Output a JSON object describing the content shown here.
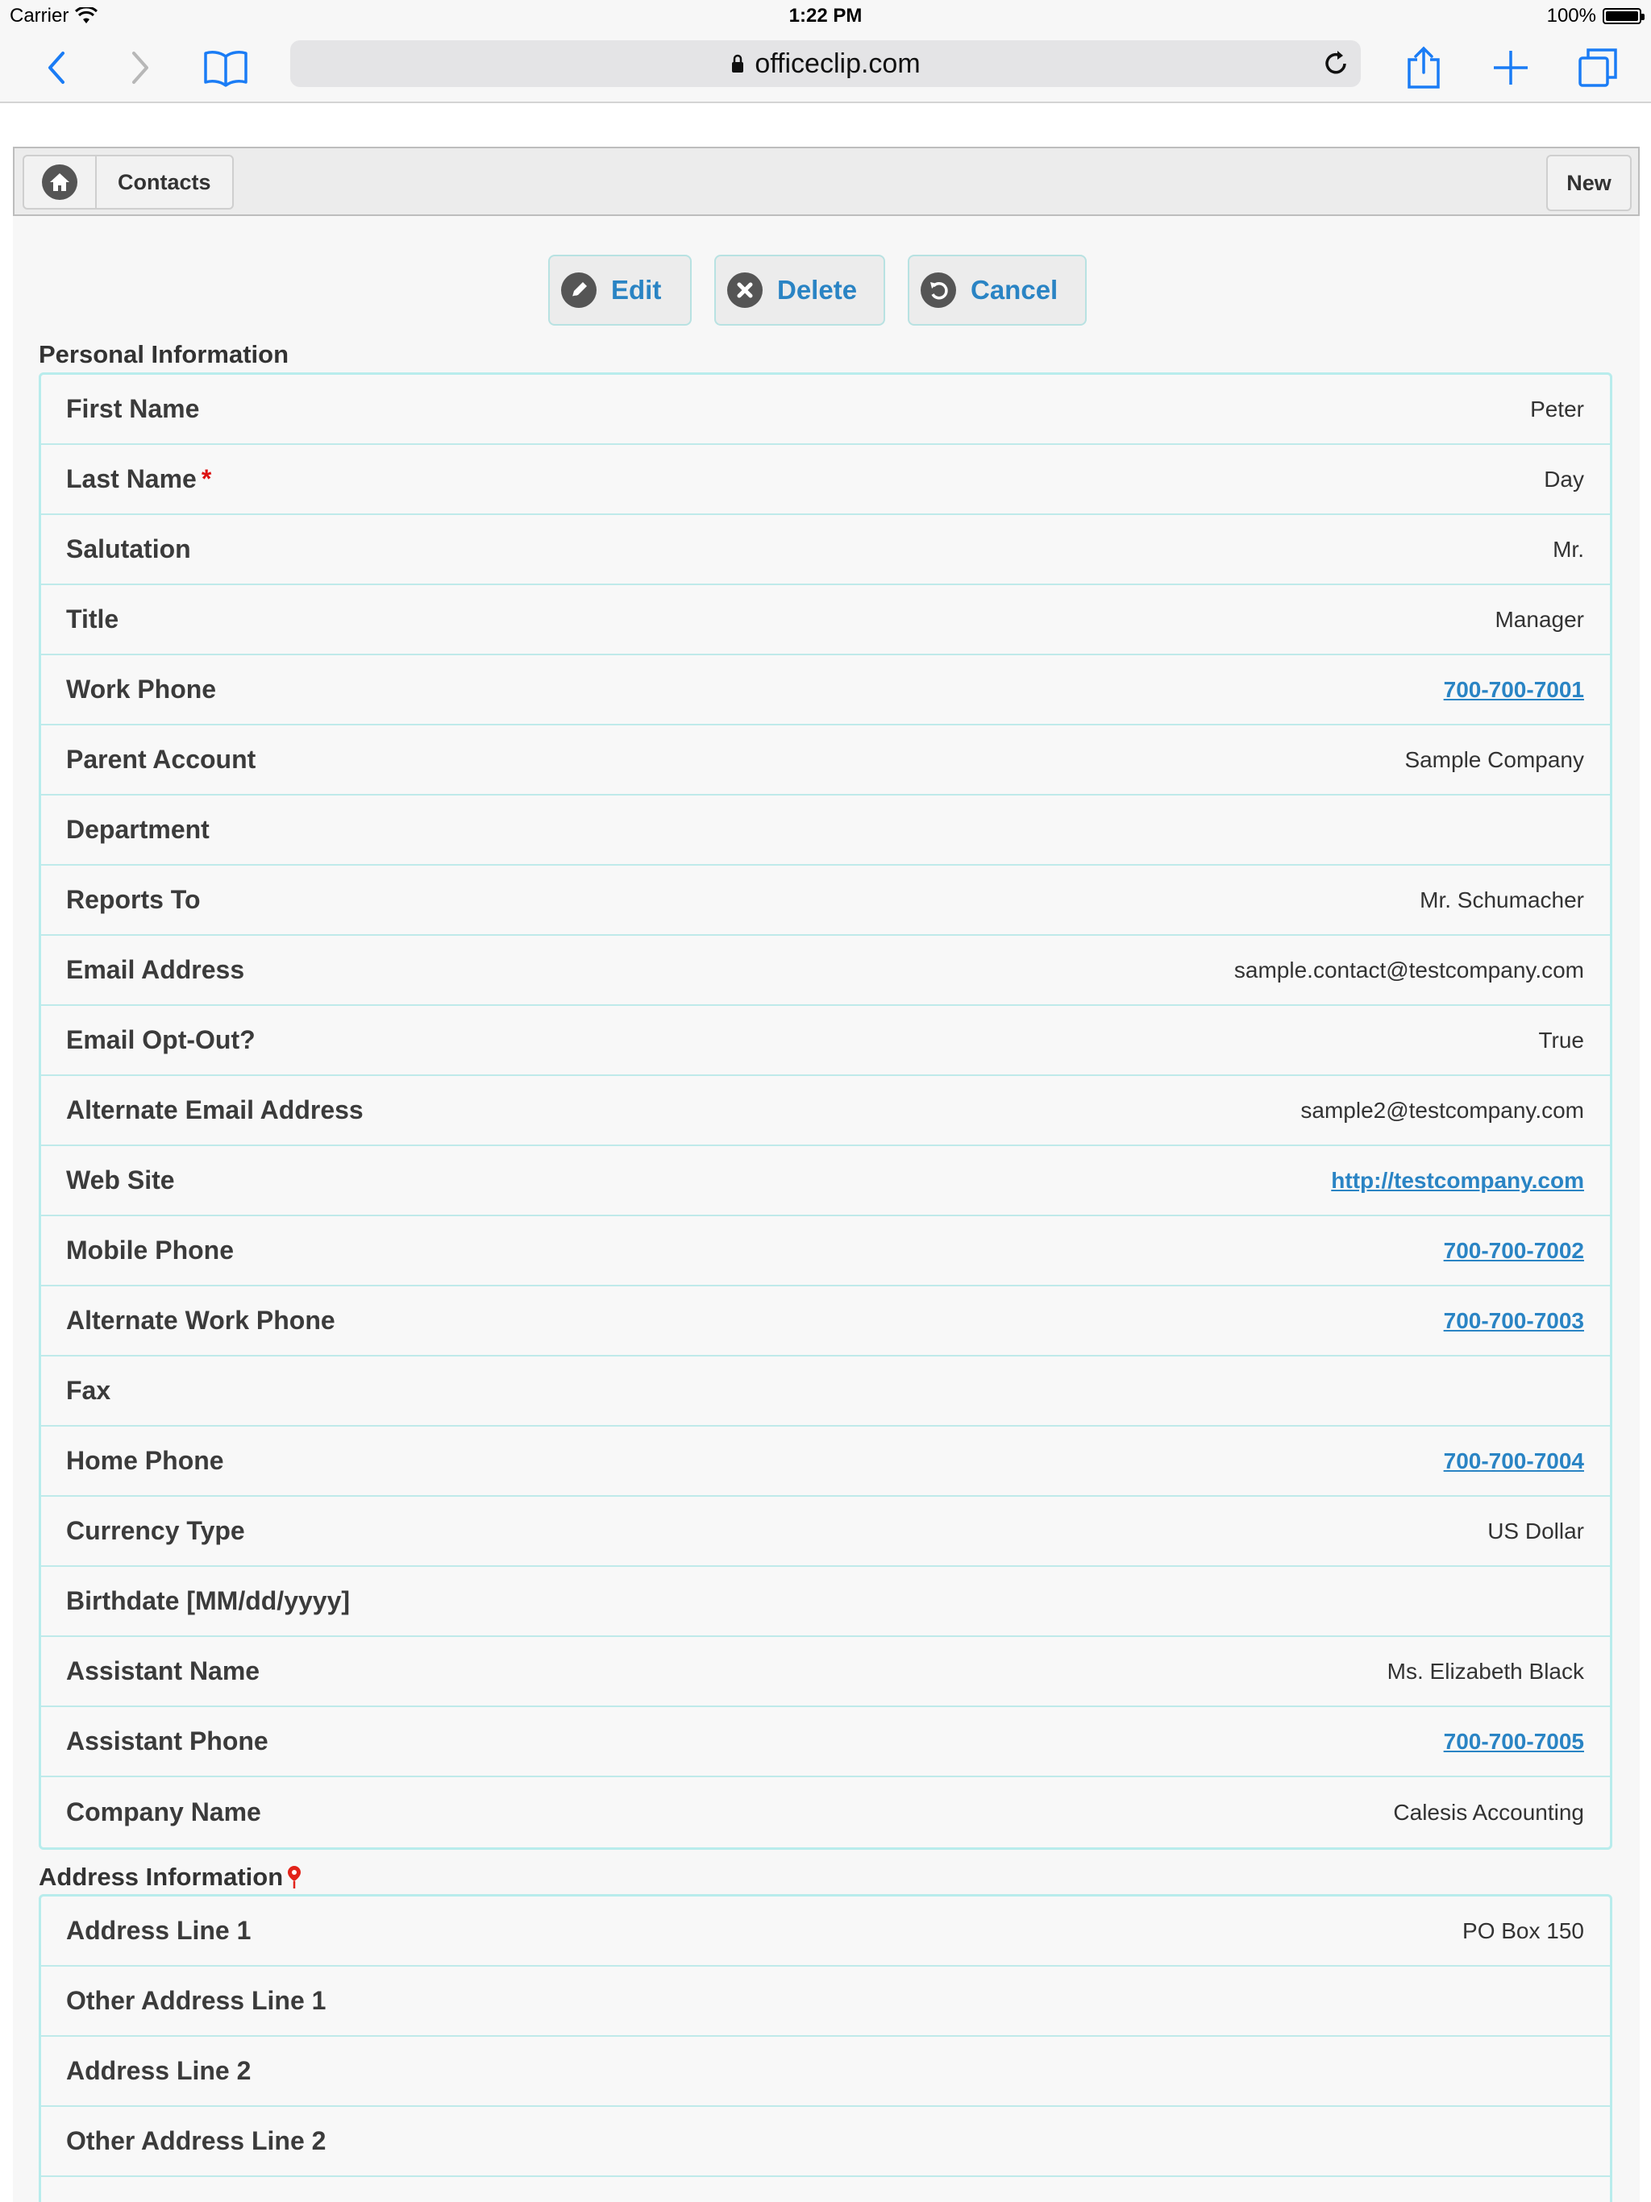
{
  "status_bar": {
    "carrier": "Carrier",
    "time": "1:22 PM",
    "battery": "100%"
  },
  "browser": {
    "url": "officeclip.com"
  },
  "header": {
    "breadcrumb": "Contacts",
    "new_label": "New"
  },
  "actions": {
    "edit": "Edit",
    "delete": "Delete",
    "cancel": "Cancel"
  },
  "personal": {
    "title": "Personal Information",
    "rows": [
      {
        "label": "First Name",
        "value": "Peter"
      },
      {
        "label": "Last Name",
        "value": "Day",
        "required": "*"
      },
      {
        "label": "Salutation",
        "value": "Mr."
      },
      {
        "label": "Title",
        "value": "Manager"
      },
      {
        "label": "Work Phone",
        "value": "700-700-7001"
      },
      {
        "label": "Parent Account",
        "value": "Sample Company"
      },
      {
        "label": "Department",
        "value": ""
      },
      {
        "label": "Reports To",
        "value": "Mr. Schumacher"
      },
      {
        "label": "Email Address",
        "value": "sample.contact@testcompany.com"
      },
      {
        "label": "Email Opt-Out?",
        "value": "True"
      },
      {
        "label": "Alternate Email Address",
        "value": "sample2@testcompany.com"
      },
      {
        "label": "Web Site",
        "value": "http://testcompany.com"
      },
      {
        "label": "Mobile Phone",
        "value": "700-700-7002"
      },
      {
        "label": "Alternate Work Phone",
        "value": "700-700-7003"
      },
      {
        "label": "Fax",
        "value": ""
      },
      {
        "label": "Home Phone",
        "value": "700-700-7004"
      },
      {
        "label": "Currency Type",
        "value": "US Dollar"
      },
      {
        "label": "Birthdate [MM/dd/yyyy]",
        "value": ""
      },
      {
        "label": "Assistant Name",
        "value": "Ms. Elizabeth Black"
      },
      {
        "label": "Assistant Phone",
        "value": "700-700-7005"
      },
      {
        "label": "Company Name",
        "value": "Calesis Accounting"
      }
    ]
  },
  "address": {
    "title": "Address Information",
    "rows": [
      {
        "label": "Address Line 1",
        "value": "PO Box 150"
      },
      {
        "label": "Other Address Line 1",
        "value": ""
      },
      {
        "label": "Address Line 2",
        "value": ""
      },
      {
        "label": "Other Address Line 2",
        "value": ""
      }
    ]
  },
  "colors": {
    "accent": "#2a84c4",
    "row_border": "#bfeaea",
    "required": "#dd1111"
  }
}
